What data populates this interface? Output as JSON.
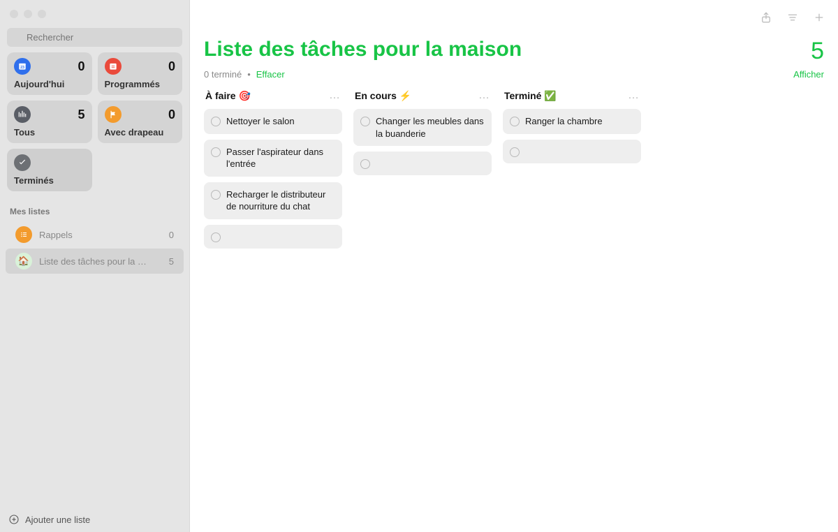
{
  "search": {
    "placeholder": "Rechercher"
  },
  "smart_cards": [
    {
      "name": "today",
      "label": "Aujourd'hui",
      "count": "0",
      "color": "#2f6fec"
    },
    {
      "name": "scheduled",
      "label": "Programmés",
      "count": "0",
      "color": "#ea4a3b"
    },
    {
      "name": "all",
      "label": "Tous",
      "count": "5",
      "color": "#5a5e66"
    },
    {
      "name": "flagged",
      "label": "Avec drapeau",
      "count": "0",
      "color": "#f39b2d"
    },
    {
      "name": "completed",
      "label": "Terminés",
      "count": "",
      "color": "#6d7074",
      "selected": true
    }
  ],
  "my_lists_header": "Mes listes",
  "lists": [
    {
      "name": "Rappels",
      "count": "0",
      "icon_color": "#f39b2d",
      "icon": "list"
    },
    {
      "name": "Liste des tâches pour la mai…",
      "count": "5",
      "icon_color": "#d9f2d9",
      "icon": "emoji",
      "emoji": "🏠",
      "selected": true
    }
  ],
  "sidebar_footer": "Ajouter une liste",
  "header": {
    "title": "Liste des tâches pour la maison",
    "count": "5",
    "completed_text": "0 terminé",
    "dot": "•",
    "clear": "Effacer",
    "show": "Afficher"
  },
  "columns": [
    {
      "title": "À faire 🎯",
      "tasks": [
        {
          "text": "Nettoyer le salon"
        },
        {
          "text": "Passer l'aspirateur dans l'entrée"
        },
        {
          "text": "Recharger le distributeur de nourriture du chat"
        },
        {
          "text": "",
          "empty": true
        }
      ]
    },
    {
      "title": "En cours ⚡️",
      "tasks": [
        {
          "text": "Changer les meubles dans la buanderie"
        },
        {
          "text": "",
          "empty": true
        }
      ]
    },
    {
      "title": "Terminé ✅",
      "tasks": [
        {
          "text": "Ranger la chambre"
        },
        {
          "text": "",
          "empty": true
        }
      ]
    }
  ]
}
